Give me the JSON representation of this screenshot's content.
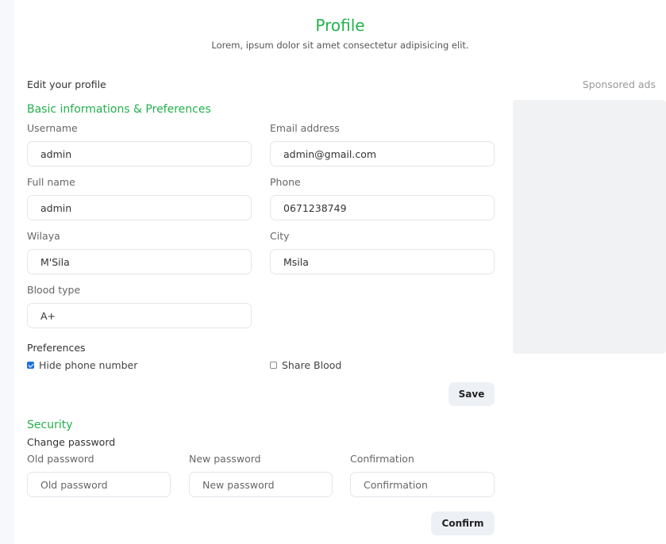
{
  "header": {
    "title": "Profile",
    "subtitle": "Lorem, ipsum dolor sit amet consectetur adipisicing elit."
  },
  "edit_title": "Edit your profile",
  "sponsored_label": "Sponsored ads",
  "basic": {
    "section_title": "Basic informations & Preferences",
    "username": {
      "label": "Username",
      "value": "admin"
    },
    "email": {
      "label": "Email address",
      "value": "admin@gmail.com"
    },
    "full_name": {
      "label": "Full name",
      "value": "admin"
    },
    "phone": {
      "label": "Phone",
      "value": "0671238749"
    },
    "wilaya": {
      "label": "Wilaya",
      "value": "M'Sila"
    },
    "city": {
      "label": "City",
      "value": "Msila"
    },
    "blood_type": {
      "label": "Blood type",
      "value": "A+"
    }
  },
  "preferences": {
    "title": "Preferences",
    "hide_phone": {
      "label": "Hide phone number",
      "checked": true
    },
    "share_blood": {
      "label": "Share Blood",
      "checked": false
    }
  },
  "save_label": "Save",
  "security": {
    "section_title": "Security",
    "change_password": "Change password",
    "old_password": {
      "label": "Old password",
      "placeholder": "Old password"
    },
    "new_password": {
      "label": "New password",
      "placeholder": "New password"
    },
    "confirmation": {
      "label": "Confirmation",
      "placeholder": "Confirmation"
    },
    "confirm_label": "Confirm"
  },
  "colors": {
    "accent": "#22b14c",
    "checkbox": "#1d6fe0",
    "button_bg": "#edf1f5",
    "ads_bg": "#f1f2f3"
  }
}
